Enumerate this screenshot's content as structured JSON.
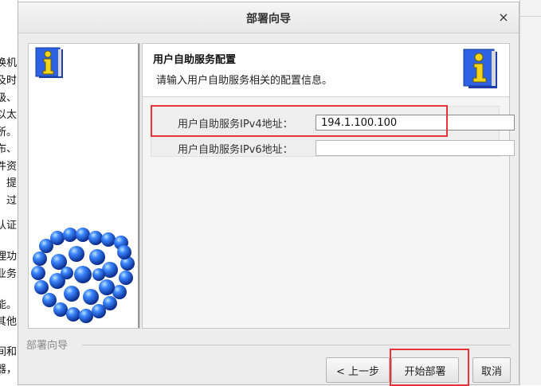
{
  "background_doc": {
    "lines": [
      "换机",
      "及时",
      "级、",
      "以太",
      "所。",
      "布、",
      "件资",
      "提",
      "过",
      "认证",
      "理功",
      "业务",
      "能。",
      "其他",
      "间和",
      "器，"
    ]
  },
  "dialog": {
    "title": "部署向导",
    "close_glyph": "×"
  },
  "header": {
    "title": "用户自助服务配置",
    "description": "请输入用户自助服务相关的配置信息。",
    "icon": "info-book-icon"
  },
  "form": {
    "ipv4_label": "用户自助服务IPv4地址：",
    "ipv4_value": "194.1.100.100",
    "ipv6_label": "用户自助服务IPv6地址：",
    "ipv6_value": ""
  },
  "group": {
    "label": "部署向导"
  },
  "buttons": {
    "prev": "< 上一步",
    "start": "开始部署",
    "cancel": "取消"
  },
  "colors": {
    "highlight": "#e8333c",
    "graphic_blue": "#1a52d8"
  }
}
